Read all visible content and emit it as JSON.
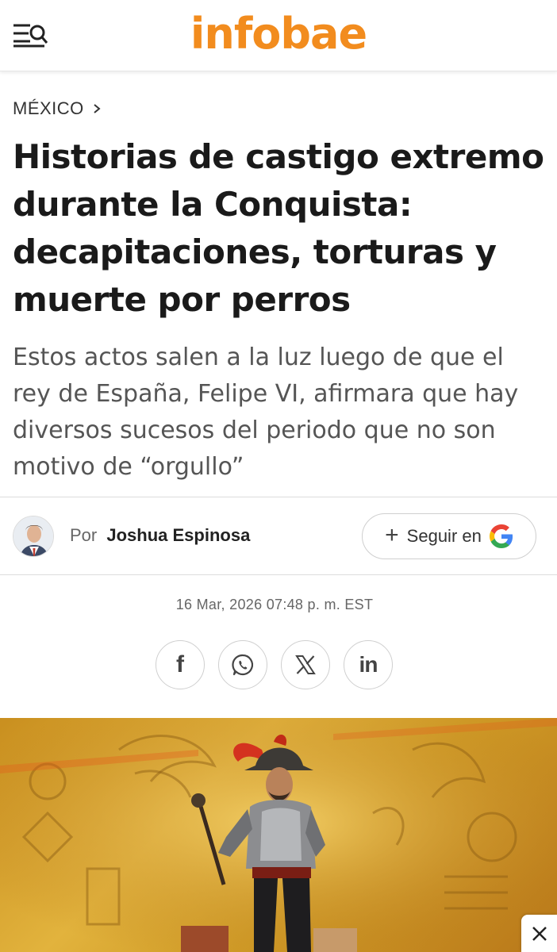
{
  "header": {
    "logo": "infobae",
    "menu_icon": "menu-search-icon",
    "brand_color": "#f28c1e"
  },
  "article": {
    "section": "MÉXICO",
    "headline": "Historias de castigo extremo durante la Conquista: decapitaciones, torturas y muerte por perros",
    "subheadline": "Estos actos salen a la luz luego de que el rey de España, Felipe VI, afirmara que hay diversos sucesos del periodo que no son motivo de “orgullo”",
    "byline_prefix": "Por",
    "author": "Joshua Espinosa",
    "follow_label": "Seguir en",
    "follow_plus": "+",
    "date": "16 Mar, 2026 07:48 p. m. EST"
  },
  "share": {
    "icons": [
      "facebook-icon",
      "whatsapp-icon",
      "x-icon",
      "linkedin-icon"
    ],
    "facebook_glyph": "f",
    "linkedin_glyph": "in"
  },
  "hero_image": {
    "subject": "conquistador",
    "close_icon": "close-icon"
  }
}
